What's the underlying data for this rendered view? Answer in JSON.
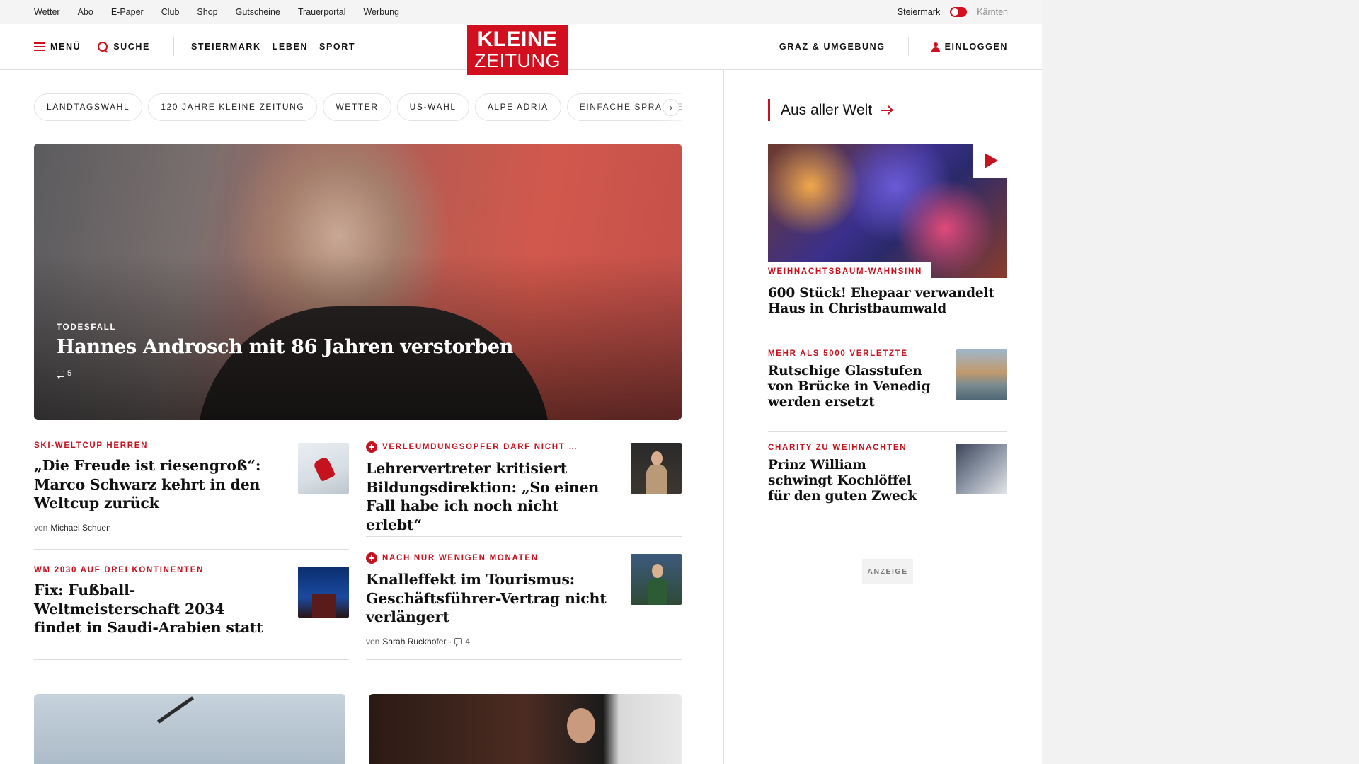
{
  "utility_nav": {
    "links": [
      "Wetter",
      "Abo",
      "E-Paper",
      "Club",
      "Shop",
      "Gutscheine",
      "Trauerportal",
      "Werbung"
    ],
    "region_active": "Steiermark",
    "region_inactive": "Kärnten"
  },
  "header": {
    "menu_label": "MENÜ",
    "search_label": "SUCHE",
    "sections": [
      "STEIERMARK",
      "LEBEN",
      "SPORT"
    ],
    "logo_line1": "KLEINE",
    "logo_line2": "ZEITUNG",
    "region_label": "GRAZ & UMGEBUNG",
    "login_label": "EINLOGGEN"
  },
  "topics": [
    "LANDTAGSWAHL",
    "120 JAHRE KLEINE ZEITUNG",
    "WETTER",
    "US-WAHL",
    "ALPE ADRIA",
    "EINFACHE SPRACHE"
  ],
  "topics_next": "›",
  "hero": {
    "kicker": "TODESFALL",
    "title": "Hannes Androsch mit 86 Jahren verstorben",
    "comments": "5"
  },
  "articles": [
    {
      "kicker": "SKI-WELTCUP HERREN",
      "title": "„Die Freude ist riesengroß“: Marco Schwarz kehrt in den Weltcup zurück",
      "by": "von",
      "author": "Michael Schuen",
      "plus": false
    },
    {
      "kicker": "VERLEUMDUNGSOPFER DARF NICHT …",
      "title": "Lehrervertreter kritisiert Bildungsdirektion: „So einen Fall habe ich noch nicht erlebt“",
      "plus": true
    },
    {
      "kicker": "WM 2030 AUF DREI KONTINENTEN",
      "title": "Fix: Fußball-Weltmeisterschaft 2034 findet in Saudi-Arabien statt",
      "plus": false
    },
    {
      "kicker": "NACH NUR WENIGEN MONATEN",
      "title": "Knalleffekt im Tourismus: Geschäftsführer-Vertrag nicht verlängert",
      "by": "von",
      "author": "Sarah Ruckhofer",
      "sep": "·",
      "comments": "4",
      "plus": true
    }
  ],
  "sidebar": {
    "section_title": "Aus aller Welt",
    "feature": {
      "kicker": "WEIHNACHTSBAUM-WAHNSINN",
      "title": "600 Stück! Ehepaar verwandelt Haus in Christbaumwald"
    },
    "items": [
      {
        "kicker": "MEHR ALS 5000 VERLETZTE",
        "title": "Rutschige Glasstufen von Brücke in Venedig werden ersetzt"
      },
      {
        "kicker": "CHARITY ZU WEIHNACHTEN",
        "title": "Prinz William schwingt Kochlöffel für den guten Zweck"
      }
    ],
    "ad_label": "ANZEIGE"
  },
  "colors": {
    "brand_red": "#d10f1f",
    "kicker_red": "#c4121f"
  }
}
